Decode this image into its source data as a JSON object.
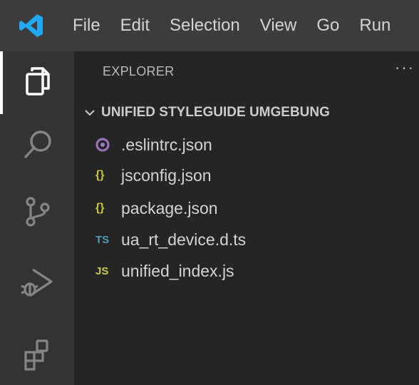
{
  "menubar": {
    "items": [
      "File",
      "Edit",
      "Selection",
      "View",
      "Go",
      "Run"
    ]
  },
  "activitybar": {
    "icons": [
      "files-icon",
      "search-icon",
      "source-control-icon",
      "run-debug-icon",
      "extensions-icon"
    ]
  },
  "sidebar": {
    "title": "EXPLORER",
    "more": "···",
    "folder": {
      "label": "UNIFIED STYLEGUIDE UMGEBUNG",
      "expanded": true,
      "files": [
        {
          "name": ".eslintrc.json",
          "icon": "eslint-icon",
          "icon_text": "",
          "color": "#a074c4"
        },
        {
          "name": "jsconfig.json",
          "icon": "json-braces-icon",
          "icon_text": "{}",
          "color": "#cbcb41"
        },
        {
          "name": "package.json",
          "icon": "json-braces-icon",
          "icon_text": "{}",
          "color": "#cbcb41"
        },
        {
          "name": "ua_rt_device.d.ts",
          "icon": "typescript-icon",
          "icon_text": "TS",
          "color": "#519aba"
        },
        {
          "name": "unified_index.js",
          "icon": "javascript-icon",
          "icon_text": "JS",
          "color": "#cbcb41"
        }
      ]
    }
  },
  "colors": {
    "menubar_bg": "#3c3c3c",
    "activitybar_bg": "#333333",
    "sidebar_bg": "#252526",
    "vscode_blue": "#23a9f2"
  }
}
